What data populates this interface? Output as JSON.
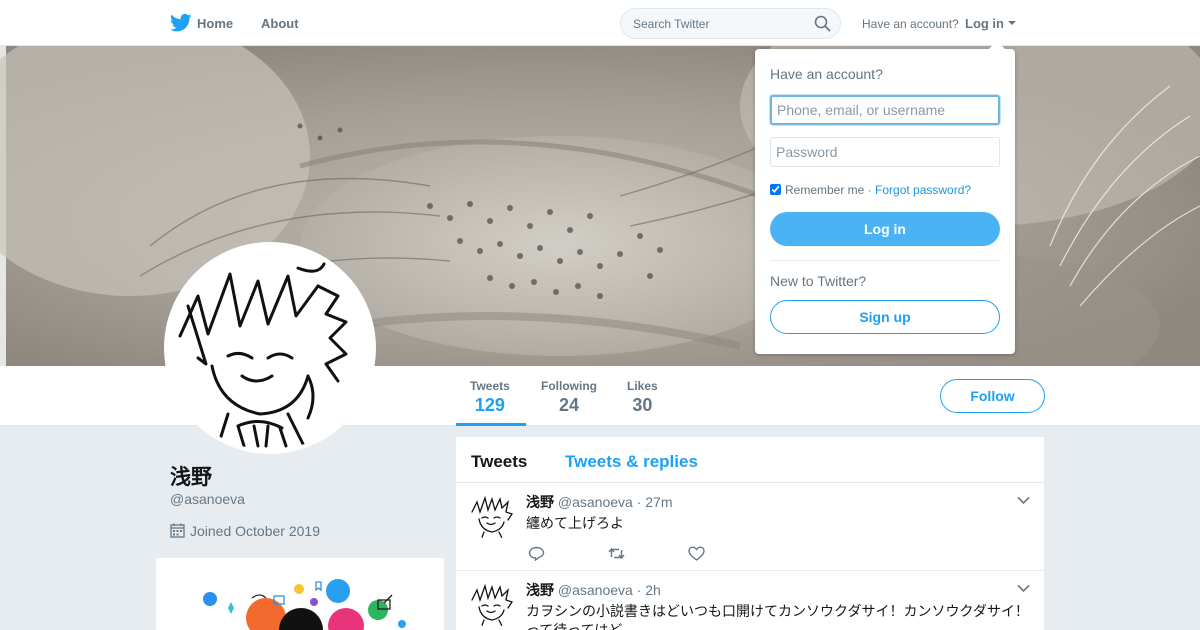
{
  "nav": {
    "logo_icon": "twitter-bird-icon",
    "home_label": "Home",
    "about_label": "About",
    "search_placeholder": "Search Twitter",
    "search_icon": "search-icon",
    "have_account_text": "Have an account?",
    "login_label": "Log in",
    "brand_color": "#1da1f2"
  },
  "profile": {
    "display_name": "浅野",
    "handle": "@asanoeva",
    "joined": "Joined October 2019",
    "follow_label": "Follow",
    "stats": [
      {
        "label": "Tweets",
        "value": "129"
      },
      {
        "label": "Following",
        "value": "24"
      },
      {
        "label": "Likes",
        "value": "30"
      }
    ]
  },
  "timeline": {
    "tabs": [
      "Tweets",
      "Tweets & replies"
    ],
    "tweets": [
      {
        "name": "浅野",
        "handle": "@asanoeva",
        "time": "· 27m",
        "text": "纏めて上げろよ"
      },
      {
        "name": "浅野",
        "handle": "@asanoeva",
        "time": "· 2h",
        "text": "カヲシンの小説書きはどいつも口開けてカンソウクダサイ！カンソウクダサイ！って待ってはど"
      }
    ]
  },
  "login_dropdown": {
    "title": "Have an account?",
    "username_placeholder": "Phone, email, or username",
    "password_placeholder": "Password",
    "remember_label": "Remember me",
    "separator": " · ",
    "forgot_label": "Forgot password?",
    "login_button": "Log in",
    "new_prompt": "New to Twitter?",
    "signup_button": "Sign up"
  }
}
